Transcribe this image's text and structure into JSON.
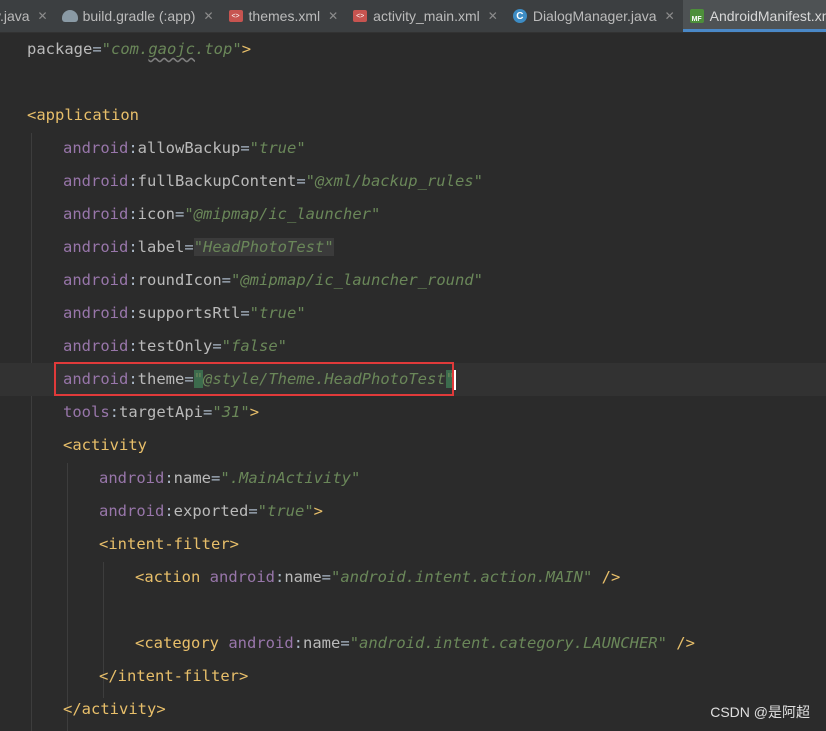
{
  "tabs": [
    {
      "label": "y.java",
      "icon": "java-icon",
      "active": false
    },
    {
      "label": "build.gradle (:app)",
      "icon": "gradle-icon",
      "active": false
    },
    {
      "label": "themes.xml",
      "icon": "xml-file-icon",
      "active": false
    },
    {
      "label": "activity_main.xml",
      "icon": "xml-file-icon",
      "active": false
    },
    {
      "label": "DialogManager.java",
      "icon": "java-class-icon",
      "active": false
    },
    {
      "label": "AndroidManifest.xml",
      "icon": "manifest-file-icon",
      "active": true
    }
  ],
  "code": {
    "l1": {
      "attr": "package",
      "eq": "=",
      "q1": "\"",
      "val_a": "com.",
      "val_b": "gaojc",
      "val_c": ".top",
      "q2": "\"",
      "end": ">"
    },
    "l3": {
      "open": "<application"
    },
    "l4": {
      "ns": "android",
      "colon": ":",
      "attr": "allowBackup",
      "eq": "=",
      "val": "\"true\""
    },
    "l5": {
      "ns": "android",
      "colon": ":",
      "attr": "fullBackupContent",
      "eq": "=",
      "val": "\"@xml/backup_rules\""
    },
    "l6": {
      "ns": "android",
      "colon": ":",
      "attr": "icon",
      "eq": "=",
      "val": "\"@mipmap/ic_launcher\""
    },
    "l7": {
      "ns": "android",
      "colon": ":",
      "attr": "label",
      "eq": "=",
      "val": "\"HeadPhotoTest\""
    },
    "l8": {
      "ns": "android",
      "colon": ":",
      "attr": "roundIcon",
      "eq": "=",
      "val": "\"@mipmap/ic_launcher_round\""
    },
    "l9": {
      "ns": "android",
      "colon": ":",
      "attr": "supportsRtl",
      "eq": "=",
      "val": "\"true\""
    },
    "l10": {
      "ns": "android",
      "colon": ":",
      "attr": "testOnly",
      "eq": "=",
      "val": "\"false\""
    },
    "l11": {
      "ns": "android",
      "colon": ":",
      "attr": "theme",
      "eq": "=",
      "q1": "\"",
      "val": "@style/Theme.HeadPhotoTest",
      "q2": "\""
    },
    "l12": {
      "ns": "tools",
      "colon": ":",
      "attr": "targetApi",
      "eq": "=",
      "val": "\"31\"",
      "end": ">"
    },
    "l13": {
      "open": "<activity"
    },
    "l14": {
      "ns": "android",
      "colon": ":",
      "attr": "name",
      "eq": "=",
      "val": "\".MainActivity\""
    },
    "l15": {
      "ns": "android",
      "colon": ":",
      "attr": "exported",
      "eq": "=",
      "val": "\"true\"",
      "end": ">"
    },
    "l16": {
      "open": "<intent-filter",
      "end": ">"
    },
    "l17": {
      "open": "<action",
      "ns": "android",
      "colon": ":",
      "attr": "name",
      "eq": "=",
      "val": "\"android.intent.action.MAIN\"",
      "end": " />"
    },
    "l19": {
      "open": "<category",
      "ns": "android",
      "colon": ":",
      "attr": "name",
      "eq": "=",
      "val": "\"android.intent.category.LAUNCHER\"",
      "end": " />"
    },
    "l20": {
      "close": "</intent-filter>"
    },
    "l21": {
      "close": "</activity>"
    }
  },
  "watermark": "CSDN @是阿超",
  "colors": {
    "background": "#2b2b2b",
    "tag": "#e8bf6a",
    "namespace": "#9876aa",
    "string": "#6a8759",
    "highlight_box": "#e03a3a"
  }
}
